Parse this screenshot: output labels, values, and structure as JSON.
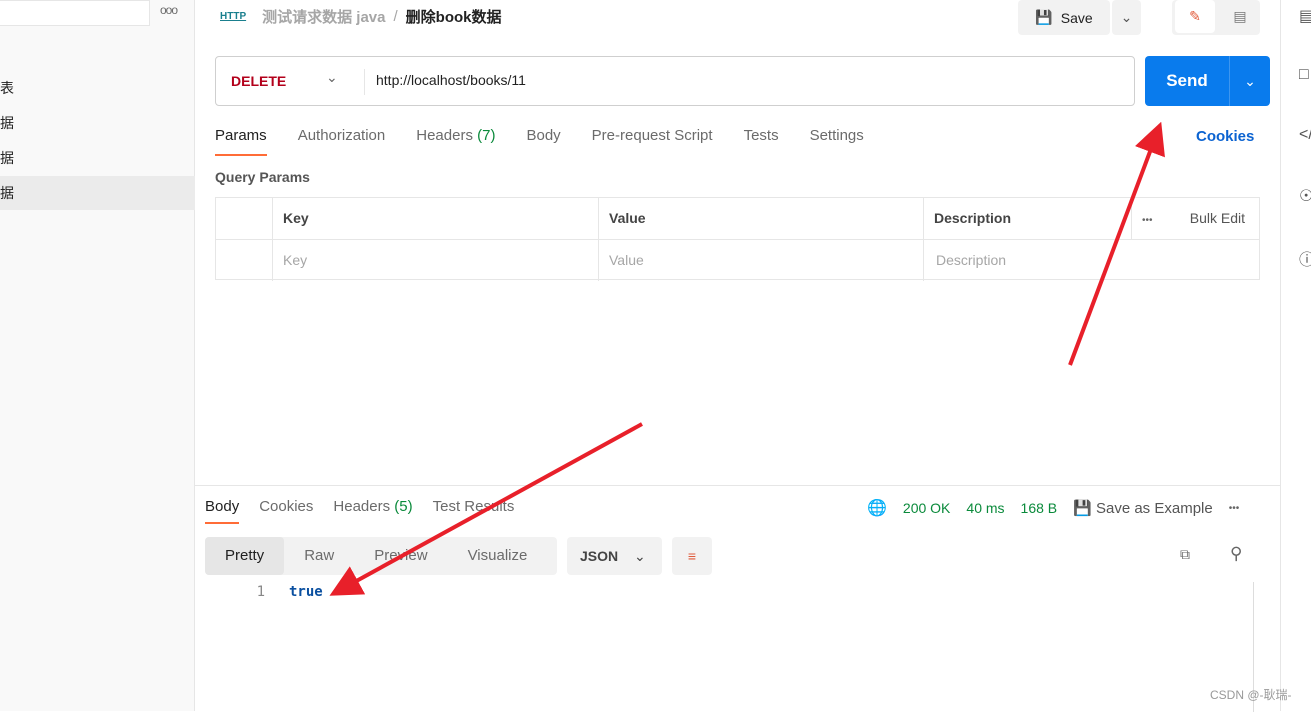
{
  "sidebar": {
    "more": "ooo",
    "items": [
      "表",
      "据",
      "据",
      "据"
    ]
  },
  "header": {
    "http_icon": "HTTP",
    "collection": "测试请求数据 java",
    "separator": "/",
    "request_name": "删除book数据",
    "save_label": "Save"
  },
  "request": {
    "method": "DELETE",
    "url": "http://localhost/books/11",
    "send_label": "Send",
    "method_color": "#b3001b",
    "send_color": "#097bed"
  },
  "tabs": [
    {
      "label": "Params"
    },
    {
      "label": "Authorization"
    },
    {
      "label": "Headers",
      "count": "(7)"
    },
    {
      "label": "Body"
    },
    {
      "label": "Pre-request Script"
    },
    {
      "label": "Tests"
    },
    {
      "label": "Settings"
    }
  ],
  "cookies_label": "Cookies",
  "query_params": {
    "title": "Query Params",
    "headers": [
      "Key",
      "Value",
      "Description"
    ],
    "bulk_edit": "Bulk Edit",
    "more": "•••",
    "placeholders": [
      "Key",
      "Value",
      "Description"
    ]
  },
  "response": {
    "tabs": [
      {
        "label": "Body"
      },
      {
        "label": "Cookies"
      },
      {
        "label": "Headers",
        "count": "(5)"
      },
      {
        "label": "Test Results"
      }
    ],
    "status": "200 OK",
    "time": "40 ms",
    "size": "168 B",
    "save_example": "Save as Example",
    "more": "•••",
    "formats": [
      "Pretty",
      "Raw",
      "Preview",
      "Visualize"
    ],
    "language": "JSON",
    "lines": [
      {
        "n": "1",
        "text": "true"
      }
    ]
  },
  "watermark": "CSDN @-耿瑞-"
}
